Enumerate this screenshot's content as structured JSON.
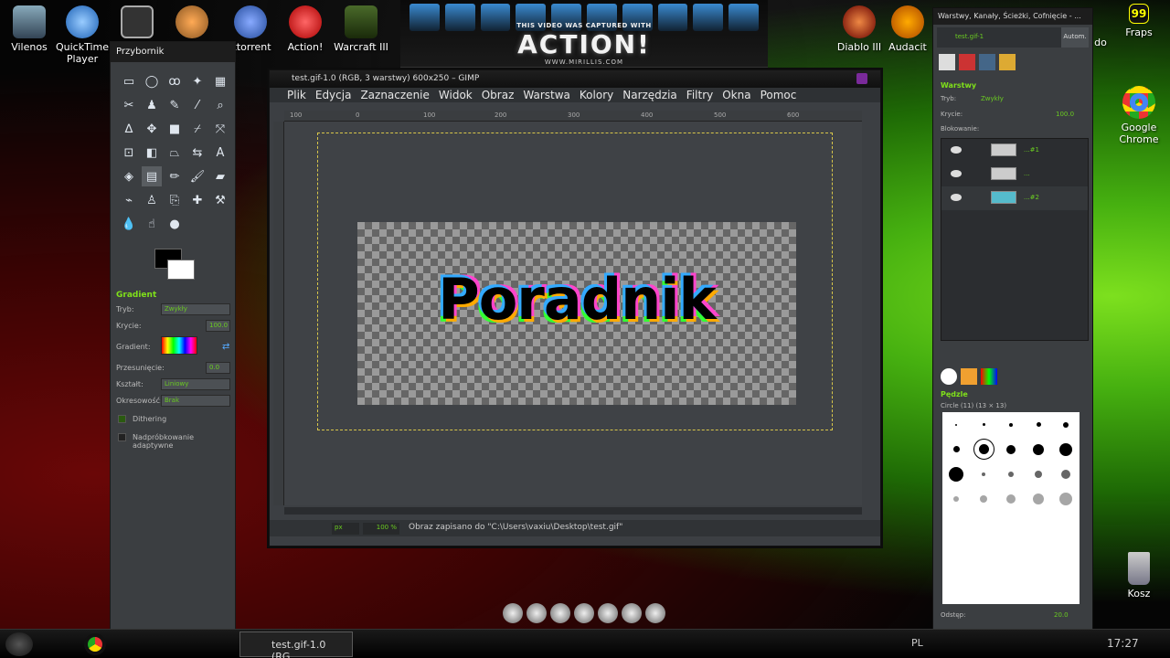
{
  "desktop": {
    "icons": [
      {
        "label": "Vilenos"
      },
      {
        "label": "QuickTime Player"
      },
      {
        "label": ""
      },
      {
        "label": ""
      },
      {
        "label": "ittorrent"
      },
      {
        "label": "Action!"
      },
      {
        "label": "Warcraft III"
      },
      {
        "label": "Diablo III"
      },
      {
        "label": "Audacit"
      },
      {
        "label": "do"
      },
      {
        "label": "Fraps"
      },
      {
        "label": "Google Chrome"
      },
      {
        "label": "Kosz"
      }
    ],
    "fraps_counter": "99"
  },
  "banner": {
    "subtitle": "THIS VIDEO WAS CAPTURED WITH",
    "brand": "ACTION!",
    "url": "WWW.MIRILLIS.COM"
  },
  "toolbox": {
    "title": "Przybornik",
    "tool_options_title": "Gradient",
    "mode_label": "Tryb:",
    "mode_value": "Zwykły",
    "opacity_label": "Krycie:",
    "opacity_value": "100.0",
    "gradient_label": "Gradient:",
    "offset_label": "Przesunięcie:",
    "offset_value": "0.0",
    "shape_label": "Kształt:",
    "shape_value": "Liniowy",
    "repeat_label": "Okresowość:",
    "repeat_value": "Brak",
    "dithering_label": "Dithering",
    "adaptive_label": "Nadpróbkowanie adaptywne"
  },
  "image_window": {
    "title": "test.gif-1.0 (RGB, 3 warstwy) 600x250 – GIMP",
    "menu": [
      "Plik",
      "Edycja",
      "Zaznaczenie",
      "Widok",
      "Obraz",
      "Warstwa",
      "Kolory",
      "Narzędzia",
      "Filtry",
      "Okna",
      "Pomoc"
    ],
    "ruler_ticks": [
      "100",
      "0",
      "100",
      "200",
      "300",
      "400",
      "500",
      "600"
    ],
    "canvas_text": "Poradnik",
    "unit": "px",
    "zoom": "100 %",
    "status_message": "Obraz zapisano do \"C:\\Users\\vaxiu\\Desktop\\test.gif\""
  },
  "layers_dock": {
    "title": "Warstwy, Kanały, Ścieżki, Cofnięcie - ...",
    "image_selector": "test.gif-1",
    "auto_button": "Autom.",
    "layers_title": "Warstwy",
    "mode_label": "Tryb:",
    "mode_value": "Zwykły",
    "opacity_label": "Krycie:",
    "opacity_value": "100.0",
    "lock_label": "Blokowanie:",
    "layers": [
      {
        "name": "...#1"
      },
      {
        "name": "..."
      },
      {
        "name": "...#2"
      }
    ],
    "brushes_title": "Pędzle",
    "brush_name": "Circle (11) (13 × 13)",
    "spacing_label": "Odstęp:",
    "spacing_value": "20.0"
  },
  "taskbar": {
    "gimp_task": "test.gif-1.0 (RG...",
    "language": "PL",
    "clock": "17:27"
  },
  "colors": {
    "accent_green": "#7fe01a",
    "panel_bg": "#3b3e41",
    "selection_yellow": "#d8c64a"
  }
}
